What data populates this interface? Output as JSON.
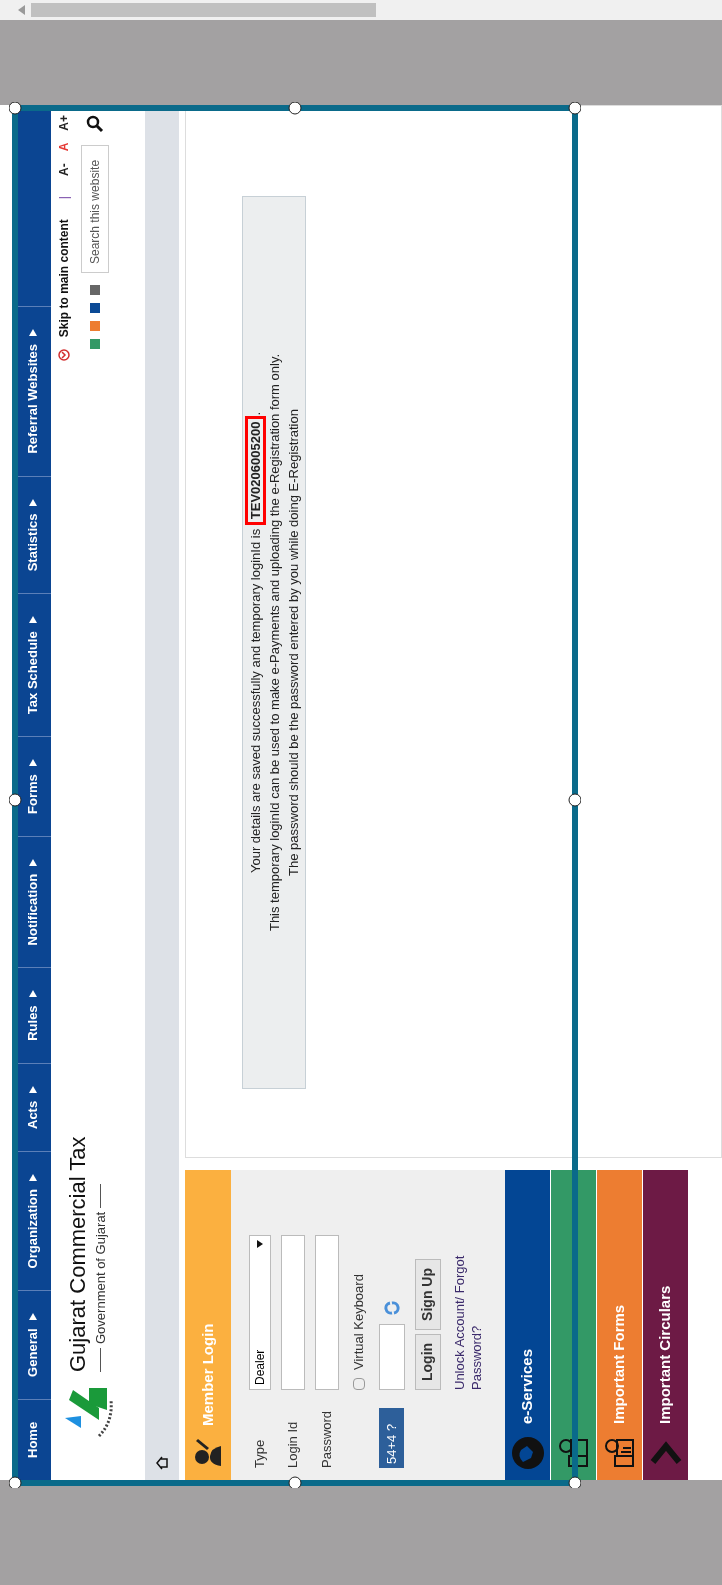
{
  "nav": {
    "items": [
      {
        "label": "Home",
        "has_menu": false
      },
      {
        "label": "General",
        "has_menu": true
      },
      {
        "label": "Organization",
        "has_menu": true
      },
      {
        "label": "Acts",
        "has_menu": true
      },
      {
        "label": "Rules",
        "has_menu": true
      },
      {
        "label": "Notification",
        "has_menu": true
      },
      {
        "label": "Forms",
        "has_menu": true
      },
      {
        "label": "Tax Schedule",
        "has_menu": true
      },
      {
        "label": "Statistics",
        "has_menu": true
      },
      {
        "label": "Referral Websites",
        "has_menu": true
      }
    ]
  },
  "header": {
    "title": "Gujarat Commercial Tax",
    "subtitle": "Government of Gujarat",
    "skip_link": "Skip to main content",
    "separator": "|",
    "font_sizes": [
      {
        "label": "A-",
        "color": "#222222"
      },
      {
        "label": "A",
        "color": "#e53935"
      },
      {
        "label": "A+",
        "color": "#222222"
      }
    ],
    "themes": [
      {
        "color": "#339966"
      },
      {
        "color": "#ed7d31"
      },
      {
        "color": "#0b4a96"
      },
      {
        "color": "#666666"
      }
    ],
    "search": {
      "placeholder": "Search this website"
    }
  },
  "member_login": {
    "title": "Member Login",
    "fields": [
      {
        "label": "Type",
        "kind": "select",
        "value": "Dealer"
      },
      {
        "label": "Login Id",
        "kind": "input"
      },
      {
        "label": "Password",
        "kind": "input"
      }
    ],
    "virtual_keyboard": {
      "label": "Virtual Keyboard",
      "checked": false
    },
    "captcha": "54+4 ?",
    "buttons": [
      "Login",
      "Sign Up"
    ],
    "link": "Unlock Account/ Forgot Password?"
  },
  "sidebar_tabs": [
    {
      "label": "e-Services",
      "color": "#034694"
    },
    {
      "color": "#339966"
    },
    {
      "label": "Important Forms",
      "color": "#ed7d31"
    },
    {
      "label": "Important Circulars",
      "color": "#6d1a45"
    }
  ],
  "message": {
    "lines": [
      "Your details are saved successfully and temporary loginId is **TEV0206005200**.",
      "This temporary loginId can be used to make e-Payments and uploading the e-Registration form only.",
      "The password should be the password entered by you while doing E-Registration"
    ]
  }
}
